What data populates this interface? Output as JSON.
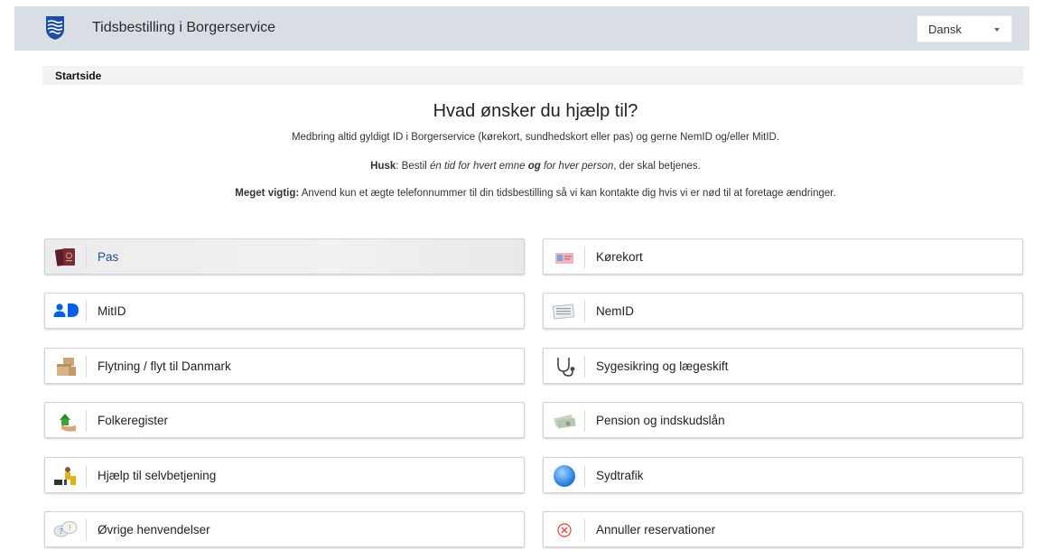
{
  "header": {
    "title": "Tidsbestilling i Borgerservice",
    "language": "Dansk"
  },
  "breadcrumb": {
    "current": "Startside"
  },
  "main": {
    "heading": "Hvad ønsker du hjælp til?",
    "info1": "Medbring altid gyldigt ID i Borgerservice (kørekort, sundhedskort eller pas) og gerne NemID og/eller MitID.",
    "info2": {
      "husk_label": "Husk",
      "part1": ": Bestil ",
      "em1": "én tid for hvert emne ",
      "bold": "og",
      "em2": " for hver person",
      "part2": ", der skal betjenes."
    },
    "info3": {
      "label": "Meget vigtig:",
      "text": " Anvend kun et ægte telefonnummer til din tidsbestilling så vi kan kontakte dig hvis vi er nød til at foretage ændringer."
    }
  },
  "services": {
    "pas": "Pas",
    "korekort": "Kørekort",
    "mitid": "MitID",
    "nemid": "NemID",
    "flytning": "Flytning / flyt til Danmark",
    "sygesikring": "Sygesikring og lægeskift",
    "folkeregister": "Folkeregister",
    "pension": "Pension og indskudslån",
    "selvbetjening": "Hjælp til selvbetjening",
    "sydtrafik": "Sydtrafik",
    "ovrige": "Øvrige henvendelser",
    "annuller": "Annuller reservationer"
  },
  "colors": {
    "header_bg": "#d9dee4",
    "active_label": "#1f4f8f",
    "mitid_blue": "#0060e6",
    "cancel_red": "#e0453a"
  }
}
